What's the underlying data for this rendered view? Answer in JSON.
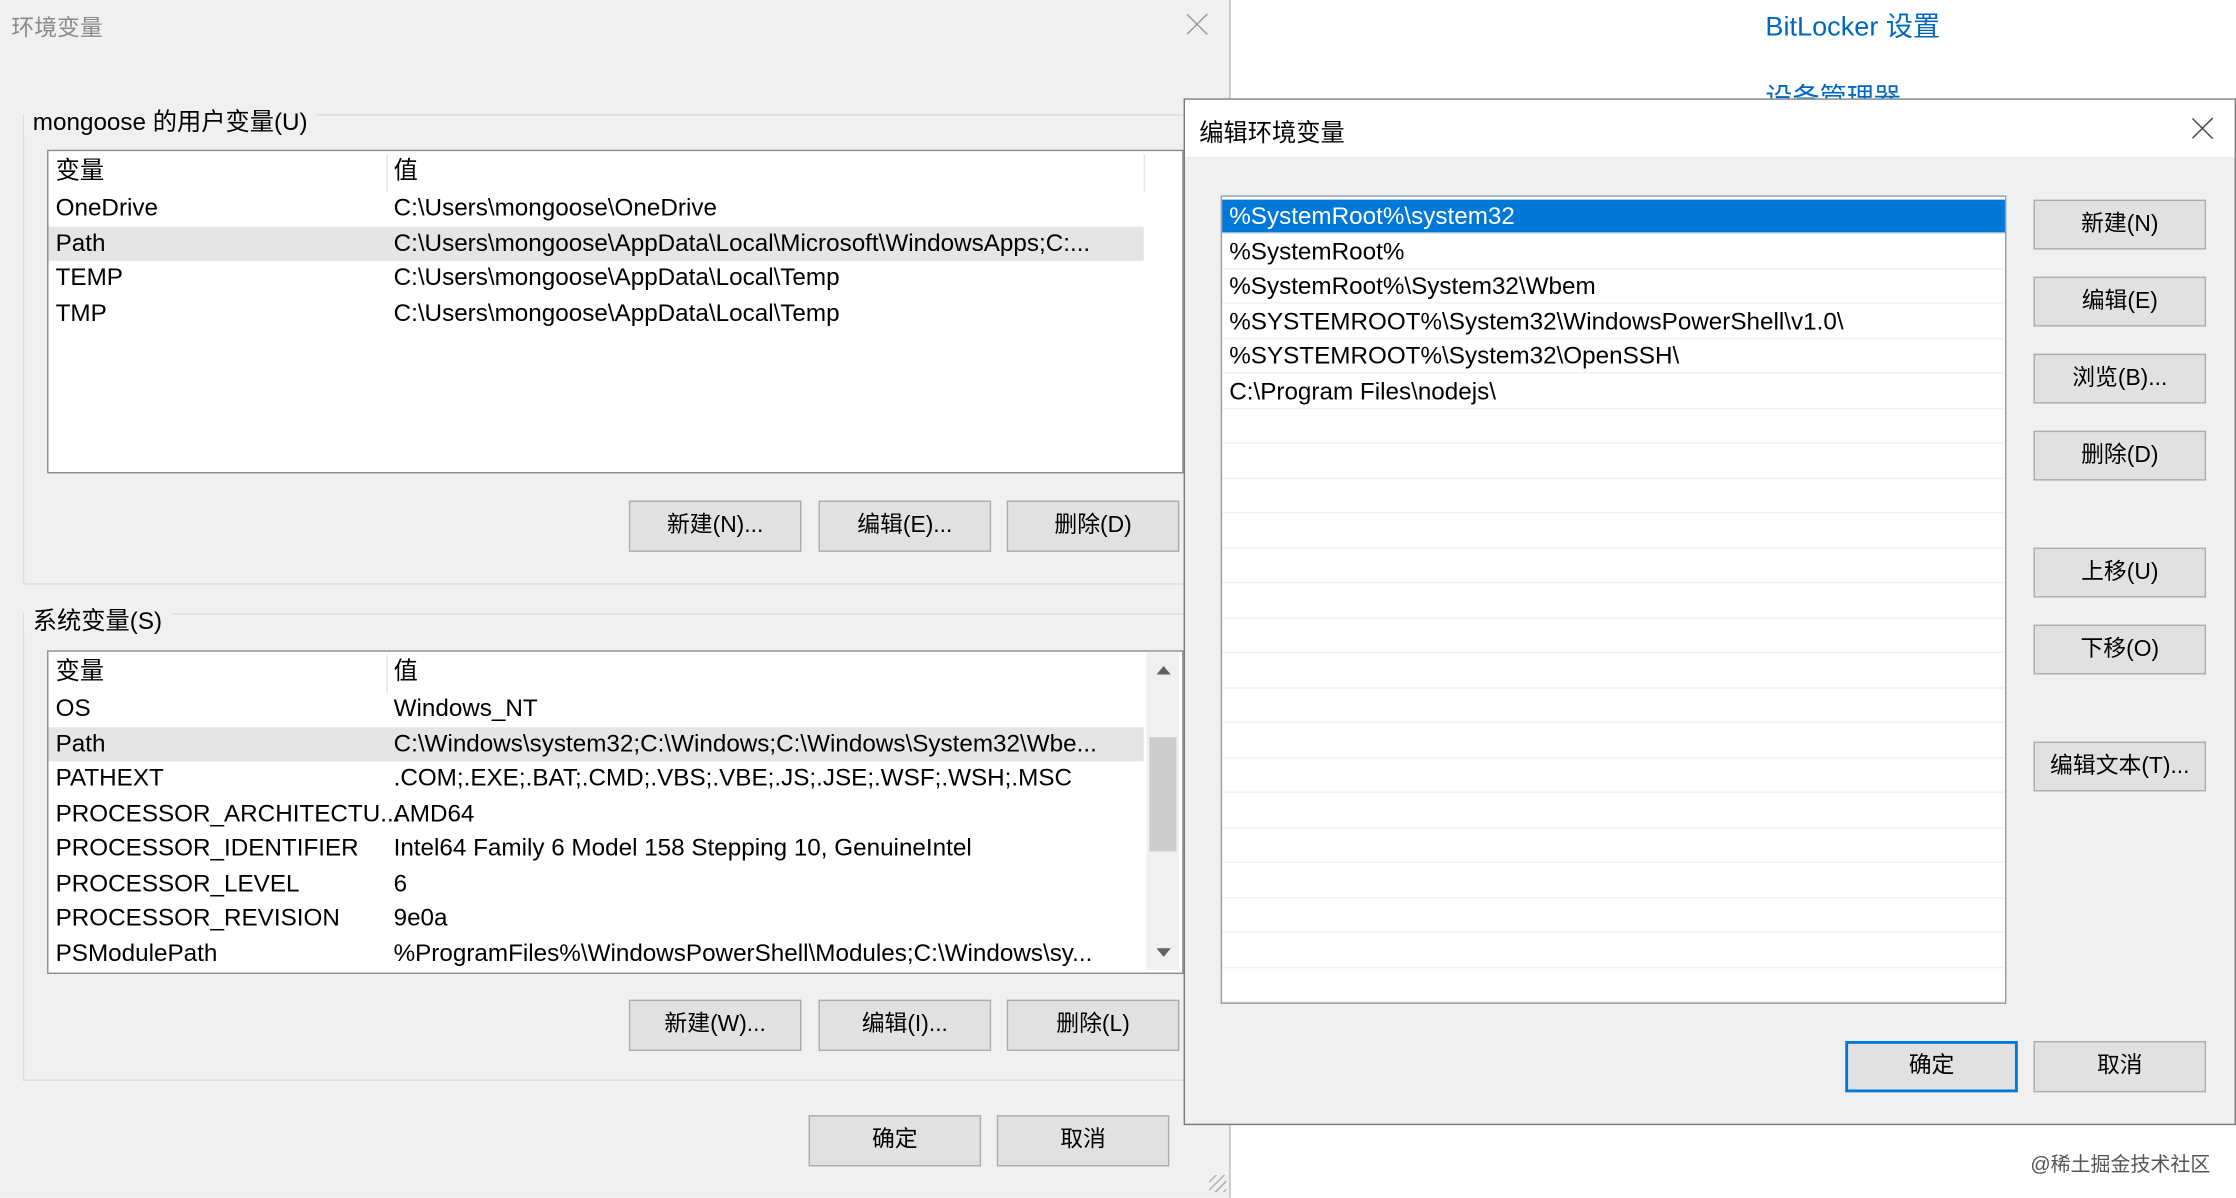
{
  "background": {
    "links": [
      "BitLocker 设置",
      "设备管理器"
    ]
  },
  "env_dialog": {
    "title": "环境变量",
    "user_group": {
      "label": "mongoose 的用户变量(U)",
      "headers": [
        "变量",
        "值"
      ],
      "rows": [
        {
          "name": "OneDrive",
          "value": "C:\\Users\\mongoose\\OneDrive"
        },
        {
          "name": "Path",
          "value": "C:\\Users\\mongoose\\AppData\\Local\\Microsoft\\WindowsApps;C:..."
        },
        {
          "name": "TEMP",
          "value": "C:\\Users\\mongoose\\AppData\\Local\\Temp"
        },
        {
          "name": "TMP",
          "value": "C:\\Users\\mongoose\\AppData\\Local\\Temp"
        }
      ],
      "selected_index": 1,
      "buttons": [
        "新建(N)...",
        "编辑(E)...",
        "删除(D)"
      ]
    },
    "system_group": {
      "label": "系统变量(S)",
      "headers": [
        "变量",
        "值"
      ],
      "rows": [
        {
          "name": "OS",
          "value": "Windows_NT"
        },
        {
          "name": "Path",
          "value": "C:\\Windows\\system32;C:\\Windows;C:\\Windows\\System32\\Wbe..."
        },
        {
          "name": "PATHEXT",
          "value": ".COM;.EXE;.BAT;.CMD;.VBS;.VBE;.JS;.JSE;.WSF;.WSH;.MSC"
        },
        {
          "name": "PROCESSOR_ARCHITECTU...",
          "value": "AMD64"
        },
        {
          "name": "PROCESSOR_IDENTIFIER",
          "value": "Intel64 Family 6 Model 158 Stepping 10, GenuineIntel"
        },
        {
          "name": "PROCESSOR_LEVEL",
          "value": "6"
        },
        {
          "name": "PROCESSOR_REVISION",
          "value": "9e0a"
        },
        {
          "name": "PSModulePath",
          "value": "%ProgramFiles%\\WindowsPowerShell\\Modules;C:\\Windows\\sy..."
        }
      ],
      "selected_index": 1,
      "buttons": [
        "新建(W)...",
        "编辑(I)...",
        "删除(L)"
      ]
    },
    "ok_label": "确定",
    "cancel_label": "取消"
  },
  "edit_dialog": {
    "title": "编辑环境变量",
    "paths": [
      "%SystemRoot%\\system32",
      "%SystemRoot%",
      "%SystemRoot%\\System32\\Wbem",
      "%SYSTEMROOT%\\System32\\WindowsPowerShell\\v1.0\\",
      "%SYSTEMROOT%\\System32\\OpenSSH\\",
      "C:\\Program Files\\nodejs\\"
    ],
    "selected_index": 0,
    "buttons": {
      "new": "新建(N)",
      "edit": "编辑(E)",
      "browse": "浏览(B)...",
      "delete": "删除(D)",
      "move_up": "上移(U)",
      "move_down": "下移(O)",
      "edit_text": "编辑文本(T)..."
    },
    "ok_label": "确定",
    "cancel_label": "取消"
  },
  "watermark": "@稀土掘金技术社区",
  "colors": {
    "accent": "#0078d7",
    "link": "#0067c0",
    "dialog_bg": "#f0f0f0"
  }
}
